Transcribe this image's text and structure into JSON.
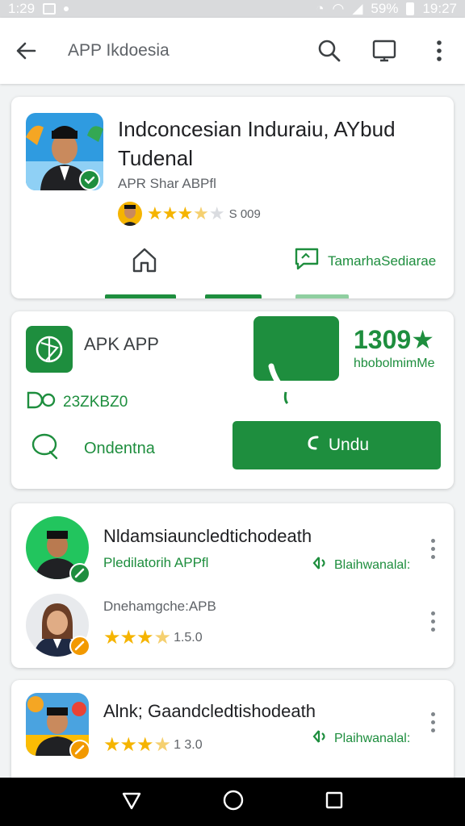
{
  "status_bar": {
    "time_left": "1:29",
    "battery": "59%",
    "time_right": "19:27"
  },
  "app_bar": {
    "title": "APP Ikdoesia"
  },
  "card1": {
    "title": "Indconcesian Induraiu, AYbud Tudenal",
    "subtitle": "APR Shar ABPfl",
    "rating_text": "S 009",
    "stars": 3.5,
    "share_label": "TamarhaSediarae"
  },
  "card2": {
    "app_name": "APK APP",
    "score": "1309★",
    "score_sub": "hbobolmimMe",
    "size_label": "23ZKBZ0",
    "link_label": "Ondentna",
    "button_label": "Undu"
  },
  "list": [
    {
      "title": "Nldamsiauncledtichodeath",
      "sub": "Pledilatorih APPfl",
      "tag": "Blaihwanalal:"
    },
    {
      "title": "Dnehamgche:APB",
      "rating_text": "1.5.0",
      "stars": 3.5
    },
    {
      "title": "Alnk; Gaandcledtishodeath",
      "rating_text": "1 3.0",
      "stars": 3.5,
      "tag": "Plaihwanalal:"
    }
  ],
  "colors": {
    "accent": "#1e8e3e",
    "star": "#f5b400",
    "badge_orange": "#f29900"
  },
  "icons": [
    "back-arrow-icon",
    "search-icon",
    "cast-icon",
    "more-vert-icon",
    "home-icon",
    "chat-icon",
    "phone-icon"
  ]
}
